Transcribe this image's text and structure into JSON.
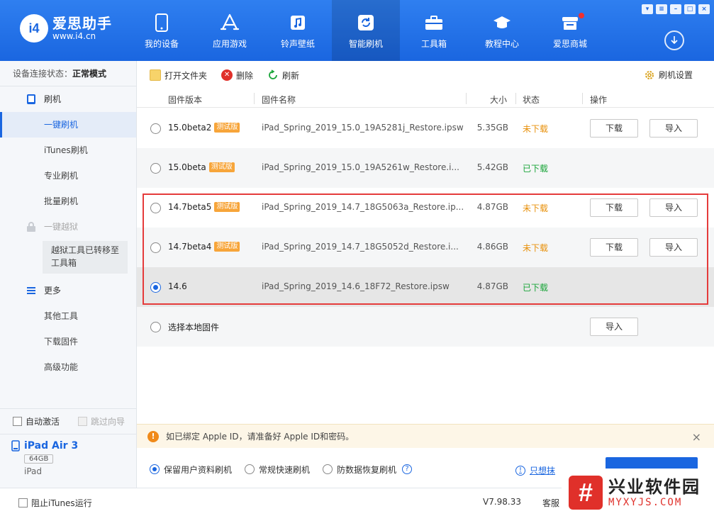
{
  "app": {
    "logo_mark": "i4",
    "name": "爱思助手",
    "url": "www.i4.cn"
  },
  "nav": [
    {
      "label": "我的设备",
      "icon": "phone-icon"
    },
    {
      "label": "应用游戏",
      "icon": "app-store-icon"
    },
    {
      "label": "铃声壁纸",
      "icon": "music-icon"
    },
    {
      "label": "智能刷机",
      "icon": "refresh-icon",
      "active": true
    },
    {
      "label": "工具箱",
      "icon": "toolbox-icon"
    },
    {
      "label": "教程中心",
      "icon": "graduation-cap-icon"
    },
    {
      "label": "爱思商城",
      "icon": "shop-icon",
      "badge": true
    }
  ],
  "sidebar": {
    "status_label": "设备连接状态：",
    "status_value": "正常模式",
    "flash_section": "刷机",
    "items": [
      {
        "label": "一键刷机",
        "active": true
      },
      {
        "label": "iTunes刷机"
      },
      {
        "label": "专业刷机"
      },
      {
        "label": "批量刷机"
      }
    ],
    "jailbreak_section": "一键越狱",
    "jailbreak_note": "越狱工具已转移至工具箱",
    "more_section": "更多",
    "more_items": [
      {
        "label": "其他工具"
      },
      {
        "label": "下载固件"
      },
      {
        "label": "高级功能"
      }
    ],
    "auto_activate": "自动激活",
    "skip_guide": "跳过向导"
  },
  "device": {
    "name": "iPad Air 3",
    "capacity": "64GB",
    "type": "iPad"
  },
  "toolbar": {
    "open_folder": "打开文件夹",
    "delete": "删除",
    "refresh": "刷新",
    "settings": "刷机设置"
  },
  "table": {
    "headers": {
      "version": "固件版本",
      "name": "固件名称",
      "size": "大小",
      "status": "状态",
      "action": "操作"
    },
    "rows": [
      {
        "version": "15.0beta2",
        "beta": "测试版",
        "name": "iPad_Spring_2019_15.0_19A5281j_Restore.ipsw",
        "size": "5.35GB",
        "status": "未下载",
        "download": "下载",
        "import": "导入"
      },
      {
        "version": "15.0beta",
        "beta": "测试版",
        "name": "iPad_Spring_2019_15.0_19A5261w_Restore.i...",
        "size": "5.42GB",
        "status": "已下载"
      },
      {
        "version": "14.7beta5",
        "beta": "测试版",
        "name": "iPad_Spring_2019_14.7_18G5063a_Restore.ip...",
        "size": "4.87GB",
        "status": "未下载",
        "download": "下载",
        "import": "导入"
      },
      {
        "version": "14.7beta4",
        "beta": "测试版",
        "name": "iPad_Spring_2019_14.7_18G5052d_Restore.i...",
        "size": "4.86GB",
        "status": "未下载",
        "download": "下载",
        "import": "导入"
      },
      {
        "version": "14.6",
        "name": "iPad_Spring_2019_14.6_18F72_Restore.ipsw",
        "size": "4.87GB",
        "status": "已下载"
      }
    ],
    "local": {
      "label": "选择本地固件",
      "import": "导入"
    }
  },
  "notice": {
    "text": "如已绑定 Apple ID，请准备好 Apple ID和密码。",
    "close": "×"
  },
  "options": [
    {
      "label": "保留用户资料刷机",
      "selected": true
    },
    {
      "label": "常规快速刷机"
    },
    {
      "label": "防数据恢复刷机"
    }
  ],
  "erase_link": "只想抹",
  "footer": {
    "itunes": "阻止iTunes运行",
    "version": "V7.98.33",
    "service": "客服"
  },
  "watermark": {
    "mark": "#",
    "cn": "兴业软件园",
    "en": "MYXYJS.COM"
  },
  "colors": {
    "primary": "#1a66e0",
    "not_downloaded": "#e8900a",
    "downloaded": "#1aa53a",
    "highlight": "#e53b3b"
  }
}
